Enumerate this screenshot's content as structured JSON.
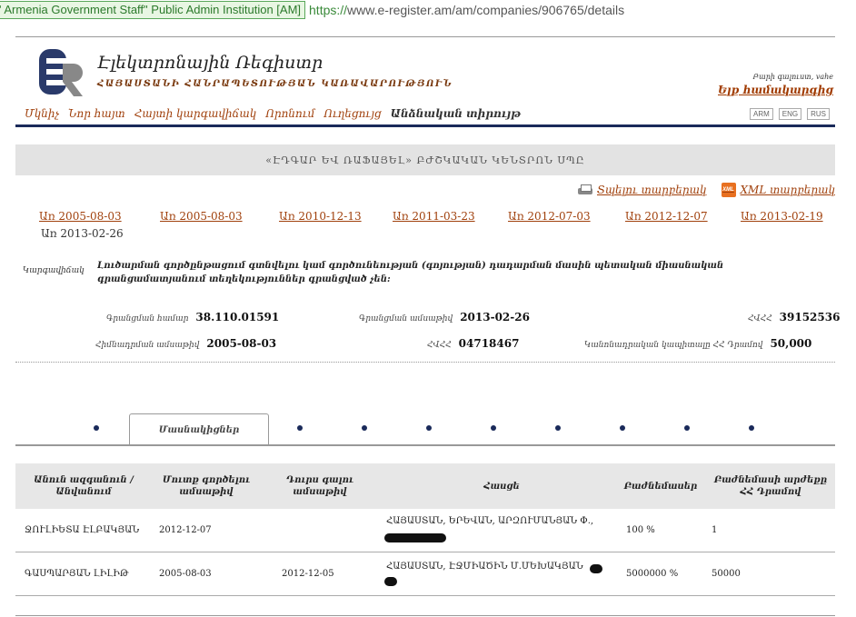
{
  "browser": {
    "ev_badge": "' Armenia Government Staff\"  Public Admin Institution [AM]",
    "url_scheme": "https://",
    "url_rest": "www.e-register.am/am/companies/906765/details"
  },
  "header": {
    "logo_letters": "ER",
    "title": "Էլեկտրոնային Ռեգիստր",
    "subtitle": "ՀԱՅԱՍՏԱՆԻ ՀԱՆՐԱՊԵՏՈՒԹՅԱՆ ԿԱՌԱՎԱՐՈՒԹՅՈՒՆ",
    "greeting": "Բարի գալուստ, vahe",
    "logout": "Ելք համակարգից"
  },
  "nav": {
    "items": [
      "Մկնիչ",
      "Նոր հայտ",
      "Հայտի կարգավիճակ",
      "Որոնում",
      "Ուղեցույց",
      "Անձնական տիրույթ"
    ],
    "langs": [
      "ARM",
      "ENG",
      "RUS"
    ]
  },
  "company": {
    "title": "«ԷԴԳԱՐ ԵՎ ՌԱՖԱՅԵԼ» ԲԺՇԿԱԿԱՆ ԿԵՆՏՐՈՆ ՍՊԸ"
  },
  "actions": {
    "print": "Տպելու տարբերակ",
    "xml_icon": "XML",
    "xml": "XML տարբերակ"
  },
  "dates": {
    "links": [
      "Առ 2005-08-03",
      "Առ 2005-08-03",
      "Առ 2010-12-13",
      "Առ 2011-03-23",
      "Առ 2012-07-03",
      "Առ 2012-12-07",
      "Առ 2013-02-19"
    ],
    "current": "Առ 2013-02-26"
  },
  "activity": {
    "label": "Կարգավիճակ",
    "text": "Լուծարման գործընթացում գտնվելու կամ գործունեության (գոյության) դադարման մասին պետական միասնական գրանցամատյանում տեղեկություններ գրանցված չեն:"
  },
  "info": {
    "reg_num_label": "Գրանցման համար",
    "reg_num": "38.110.01591",
    "reg_date_label": "Գրանցման ամսաթիվ",
    "reg_date": "2013-02-26",
    "hvhh_label": "ՀՎՀՀ",
    "hvhh": "39152536",
    "found_date_label": "Հիմնադրման ամսաթիվ",
    "found_date": "2005-08-03",
    "hchh_label": "ՀՎՀՀ",
    "hchh": "04718467",
    "capital_label": "Կանոնադրական կապիտալը ՀՀ Դրամով",
    "capital": "50,000"
  },
  "tabs": {
    "active": "Մասնակիցներ"
  },
  "table": {
    "headers": [
      "Անուն ազգանուն / Անվանում",
      "Մուտք գործելու ամսաթիվ",
      "Դուրս գալու ամսաթիվ",
      "Հասցե",
      "Բաժնեմասեր",
      "Բաժնեմասի արժեքը ՀՀ Դրամով"
    ],
    "rows": [
      {
        "name": "ՋՈՒԼԻԵՏԱ ԷԼԲԱԿՅԱՆ",
        "entry": "2012-12-07",
        "exit": "",
        "address": "ՀԱՅԱՍՏԱՆ, ԵՐԵՎԱՆ, ԱՐԶՈՒՄԱՆՅԱՆ Փ.,",
        "share": "100 %",
        "value": "1"
      },
      {
        "name": "ԳԱՍՊԱՐՅԱՆ ԼԻԼԻԹ",
        "entry": "2005-08-03",
        "exit": "2012-12-05",
        "address": "ՀԱՅԱՍՏԱՆ, ԷՋՄԻԱԾԻՆ Մ.ՄԵԽԱԿՅԱՆ",
        "share": "5000000 %",
        "value": "50000"
      }
    ]
  }
}
